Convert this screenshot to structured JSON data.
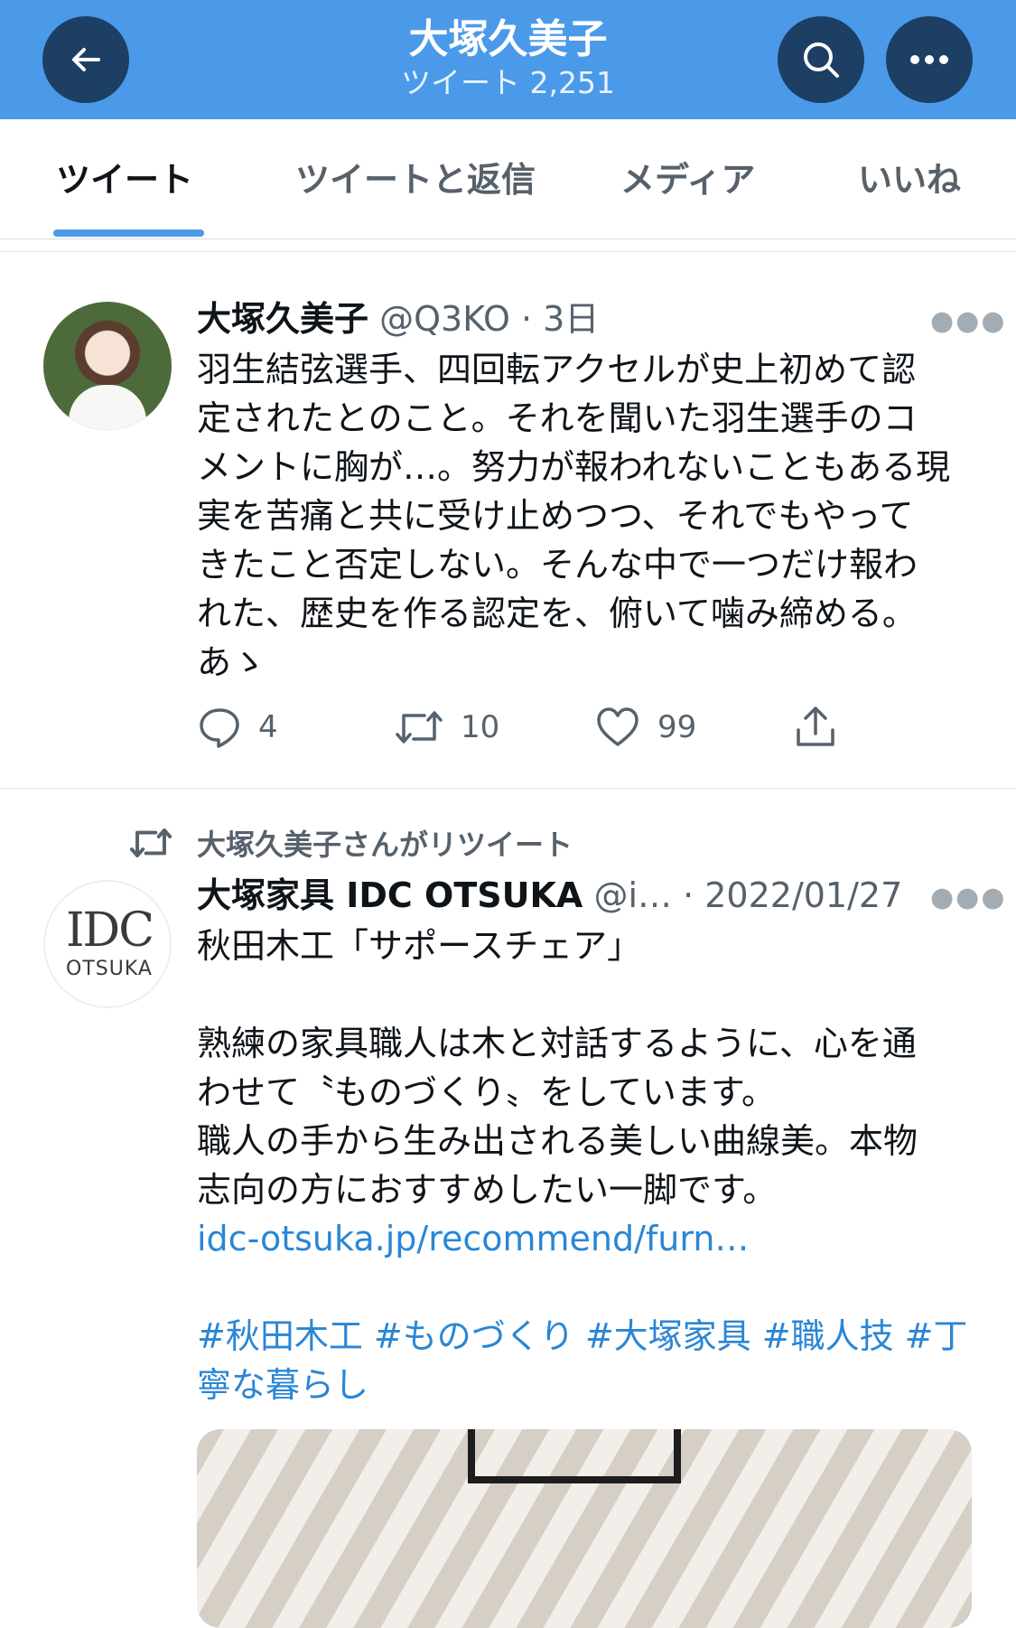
{
  "header": {
    "title": "大塚久美子",
    "subtitle": "ツイート 2,251"
  },
  "tabs": [
    {
      "label": "ツイート",
      "active": true
    },
    {
      "label": "ツイートと返信",
      "active": false
    },
    {
      "label": "メディア",
      "active": false
    },
    {
      "label": "いいね",
      "active": false
    }
  ],
  "tweets": [
    {
      "name": "大塚久美子",
      "meta": "@Q3KO · 3日",
      "text": "羽生結弦選手、四回転アクセルが史上初めて認\n定されたとのこと。それを聞いた羽生選手のコ\nメントに胸が…。努力が報われないこともある現\n実を苦痛と共に受け止めつつ、それでもやって\nきたこと否定しない。そんな中で一つだけ報わ\nれた、歴史を作る認定を、俯いて噛み締める。\nあゝ",
      "replies": "4",
      "retweets": "10",
      "likes": "99"
    },
    {
      "retweet_label": "大塚久美子さんがリツイート",
      "name": "大塚家具 IDC OTSUKA",
      "meta": "@i… · 2022/01/27",
      "text_main": "秋田木工「サポースチェア」\n\n熟練の家具職人は木と対話するように、心を通\nわせて〝ものづくり〟をしています。\n職人の手から生み出される美しい曲線美。本物\n志向の方におすすめしたい一脚です。",
      "link": "idc-otsuka.jp/recommend/furn…",
      "hashtags": "#秋田木工 #ものづくり #大塚家具 #職人技 #丁\n寧な暮らし",
      "avatar_logo": "IDC",
      "avatar_sub": "OTSUKA"
    }
  ],
  "colors": {
    "header_bg": "#4a9ae9",
    "header_button": "#1d3f63",
    "link": "#2a86d4",
    "muted": "#56616b"
  },
  "icons": [
    "back-arrow-icon",
    "search-icon",
    "more-icon",
    "reply-icon",
    "retweet-icon",
    "like-icon",
    "share-icon"
  ]
}
